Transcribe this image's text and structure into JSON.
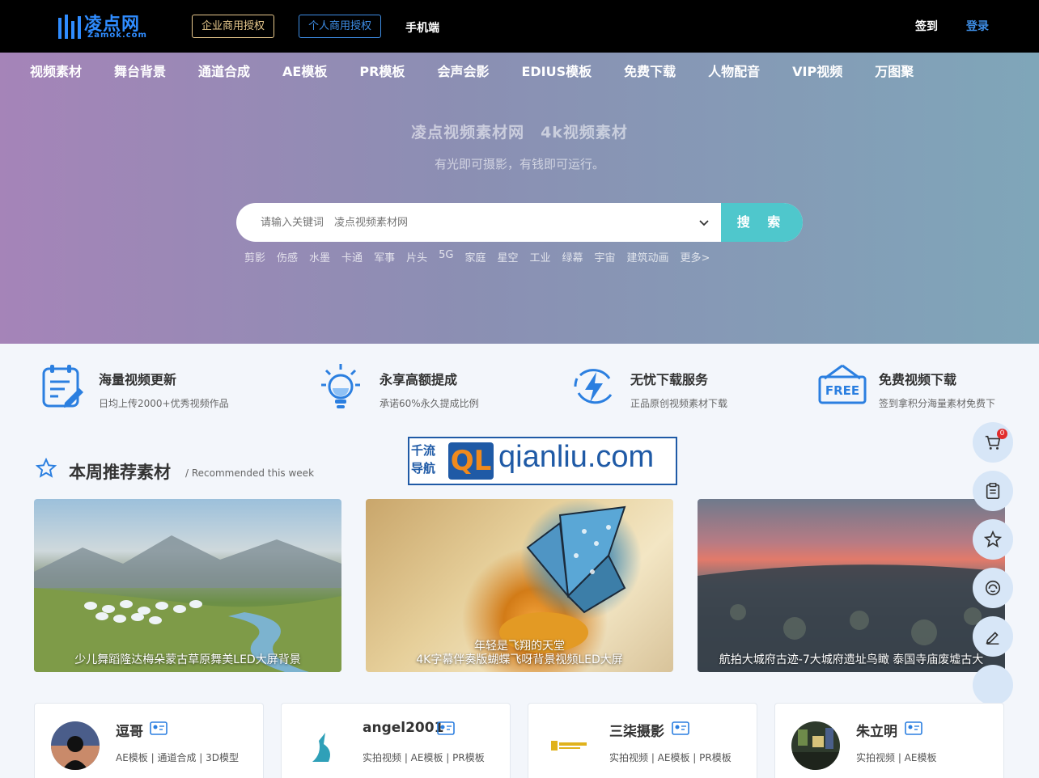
{
  "brand": {
    "logo_cn": "凌点网",
    "logo_en": "Zamok.com"
  },
  "topbar": {
    "enterprise_license": "企业商用授权",
    "personal_license": "个人商用授权",
    "mobile": "手机端",
    "signin": "签到",
    "login": "登录"
  },
  "nav": [
    "视频素材",
    "舞台背景",
    "通道合成",
    "AE模板",
    "PR模板",
    "会声会影",
    "EDIUS模板",
    "免费下载",
    "人物配音",
    "VIP视频",
    "万图聚"
  ],
  "hero": {
    "title": "凌点视频素材网　4k视频素材",
    "subtitle": "有光即可摄影，有钱即可运行。",
    "search_placeholder": "请输入关键词　凌点视频素材网",
    "search_button": "搜 索",
    "tags": [
      "剪影",
      "伤感",
      "水墨",
      "卡通",
      "军事",
      "片头",
      "5G",
      "家庭",
      "星空",
      "工业",
      "绿幕",
      "宇宙",
      "建筑动画",
      "更多>"
    ]
  },
  "features": [
    {
      "title": "海量视频更新",
      "desc": "日均上传2000+优秀视频作品",
      "icon": "clipboard-pen-icon"
    },
    {
      "title": "永享高额提成",
      "desc": "承诺60%永久提成比例",
      "icon": "lightbulb-icon"
    },
    {
      "title": "无忧下载服务",
      "desc": "正品原创视频素材下载",
      "icon": "lightning-icon"
    },
    {
      "title": "免费视频下载",
      "desc": "签到拿积分海量素材免费下",
      "icon": "free-sign-icon",
      "badge": "FREE"
    }
  ],
  "section": {
    "title": "本周推荐素材",
    "subtitle": "/ Recommended this week"
  },
  "watermark": {
    "cn": "千流导航",
    "mark": "QL",
    "domain": "qianliu.com"
  },
  "cards": [
    {
      "caption": "少儿舞蹈隆达梅朵蒙古草原舞美LED大屏背景"
    },
    {
      "caption": "年轻是飞翔的天堂\n4K字幕伴奏版蝴蝶飞呀背景视频LED大屏"
    },
    {
      "caption": "航拍大城府古迹-7大城府遗址鸟瞰 泰国寺庙废墟古大"
    }
  ],
  "cart_count": "0",
  "authors": [
    {
      "name": "逗哥",
      "tags": "AE模板 | 通道合成 | 3D模型"
    },
    {
      "name": "angel2001",
      "tags": "实拍视频 | AE模板 | PR模板"
    },
    {
      "name": "三柒摄影",
      "tags": "实拍视频 | AE模板 | PR模板"
    },
    {
      "name": "朱立明",
      "tags": "实拍视频 | AE模板"
    }
  ],
  "colors": {
    "accent": "#4fc7cc",
    "brand_blue": "#2f8cff",
    "gold": "#e8c98d"
  }
}
